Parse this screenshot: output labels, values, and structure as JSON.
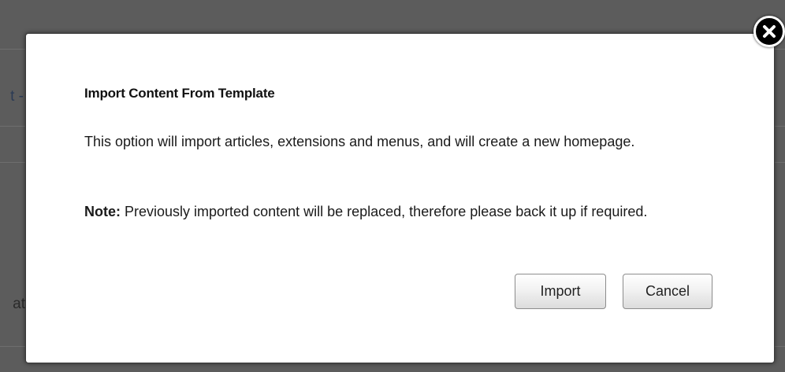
{
  "background": {
    "partial_text_1": "t -",
    "partial_text_2": "at"
  },
  "dialog": {
    "title": "Import Content From Template",
    "description": "This option will import articles, extensions and menus, and will create a new homepage.",
    "note_label": "Note:",
    "note_text": " Previously imported content will be replaced, therefore please back it up if required.",
    "import_label": "Import",
    "cancel_label": "Cancel",
    "close_icon": "close-icon"
  }
}
